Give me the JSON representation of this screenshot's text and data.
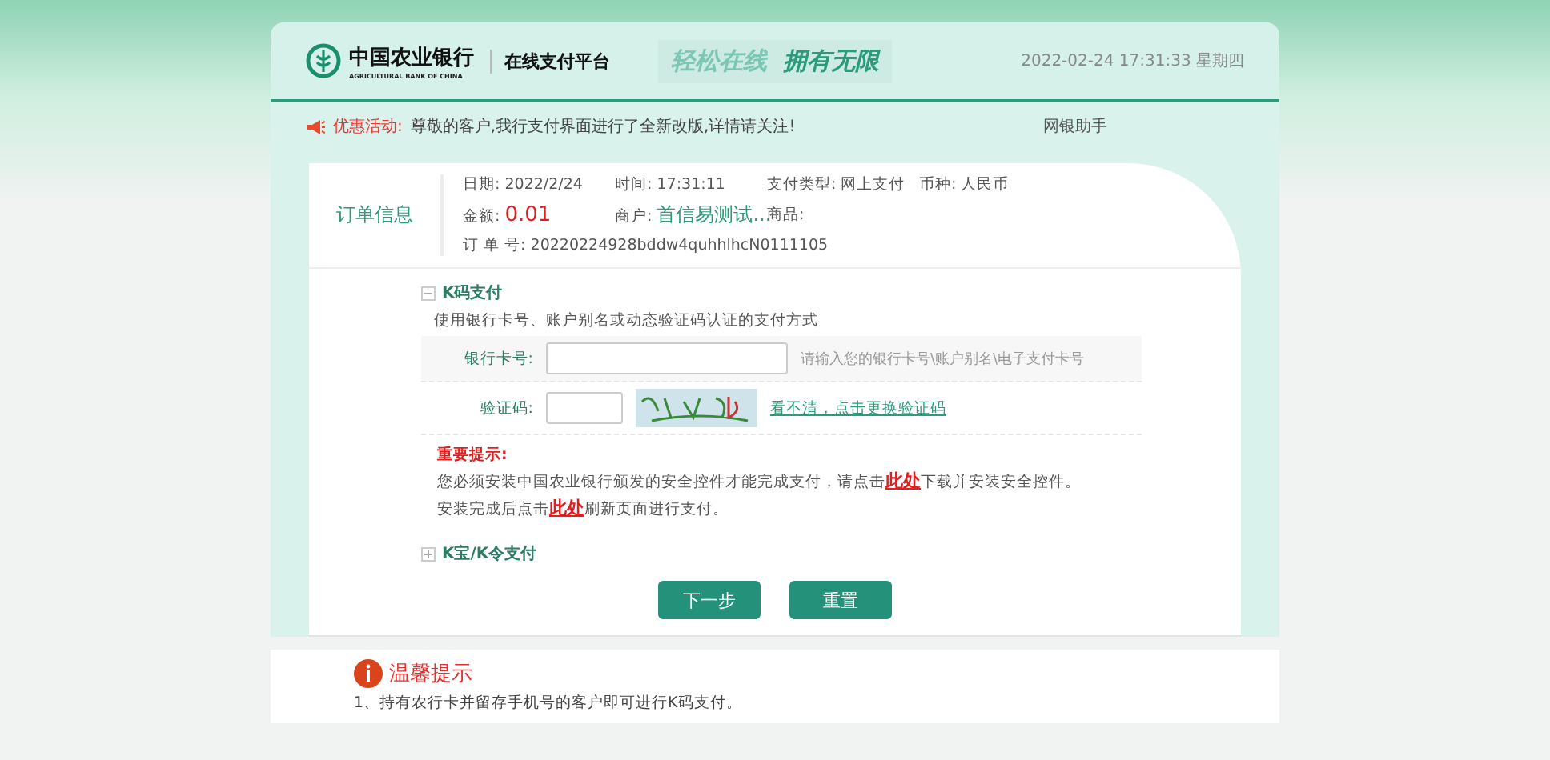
{
  "header": {
    "bank_name": "中国农业银行",
    "bank_name_en": "AGRICULTURAL BANK OF CHINA",
    "platform": "在线支付平台",
    "slogan_1": "轻松在线",
    "slogan_2": "拥有无限",
    "datetime": "2022-02-24 17:31:33 星期四"
  },
  "notice": {
    "label": "优惠活动:",
    "text": "尊敬的客户,我行支付界面进行了全新改版,详情请关注!",
    "helper_link": "网银助手"
  },
  "order": {
    "title": "订单信息",
    "fields": [
      {
        "label": "日期:",
        "value": "2022/2/24",
        "kind": "plain"
      },
      {
        "label": "时间:",
        "value": "17:31:11",
        "kind": "plain"
      },
      {
        "label": "支付类型:",
        "value": "网上支付",
        "kind": "plain"
      },
      {
        "label": "币种:",
        "value": "人民币",
        "kind": "plain"
      },
      {
        "label": "金额:",
        "value": "0.01",
        "kind": "amount"
      },
      {
        "label": "商户:",
        "value": "首信易测试...",
        "kind": "merchant"
      },
      {
        "label": "商品:",
        "kind": "plain"
      }
    ],
    "order_no_label": "订 单 号:",
    "order_no": "20220224928bddw4quhhlhcN0111105"
  },
  "methods": [
    {
      "title": "K码支付",
      "expanded": true,
      "description": "使用银行卡号、账户别名或动态验证码认证的支付方式",
      "card_label": "银行卡号:",
      "card_hint": "请输入您的银行卡号\\账户别名\\电子支付卡号",
      "code_label": "验证码:",
      "refresh_link": "看不清，点击更换验证码",
      "warning_title": "重要提示:",
      "warning_lines": [
        {
          "before": "您必须安装中国农业银行颁发的安全控件才能完成支付，请点击",
          "link": "此处",
          "after": "下载并安装安全控件。"
        },
        {
          "before": "安装完成后点击",
          "link": "此处",
          "after": "刷新页面进行支付。"
        }
      ]
    },
    {
      "title": "K宝/K令支付",
      "expanded": false
    }
  ],
  "buttons": [
    "下一步",
    "重置"
  ],
  "tips": {
    "title": "温馨提示",
    "items": [
      "1、持有农行卡并留存手机号的客户即可进行K码支付。"
    ]
  }
}
